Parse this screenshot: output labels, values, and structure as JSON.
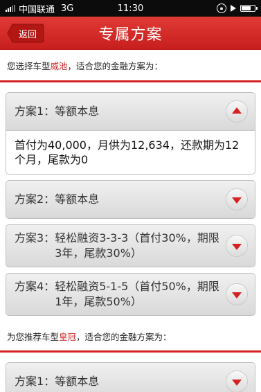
{
  "status": {
    "carrier": "中国联通",
    "network": "3G",
    "time": "11:30",
    "battery_level": 0.7
  },
  "nav": {
    "back_label": "返回",
    "title": "专属方案"
  },
  "section1": {
    "pre": "您选择车型",
    "car": "威池",
    "post": "，适合您的金融方案为："
  },
  "plans1": [
    {
      "prefix": "方案1：",
      "text": "等额本息",
      "expanded": true,
      "detail": "首付为40,000，月供为12,634，还款期为12个月，尾款为0"
    },
    {
      "prefix": "方案2：",
      "text": "等额本息",
      "expanded": false
    },
    {
      "prefix": "方案3：",
      "text": "轻松融资3-3-3（首付30%，期限3年，尾款30%）",
      "expanded": false
    },
    {
      "prefix": "方案4：",
      "text": "轻松融资5-1-5（首付50%，期限1年，尾款50%）",
      "expanded": false
    }
  ],
  "section2": {
    "pre": "为您推荐车型",
    "car": "皇冠",
    "post": "，适合您的金融方案为："
  },
  "plans2": [
    {
      "prefix": "方案1：",
      "text": "等额本息",
      "expanded": false
    }
  ],
  "colors": {
    "accent": "#d42222",
    "nav_top": "#e03a36",
    "nav_bottom": "#c61e1c"
  },
  "icons": {
    "collapse": "triangle-up-icon",
    "expand": "triangle-down-icon"
  }
}
